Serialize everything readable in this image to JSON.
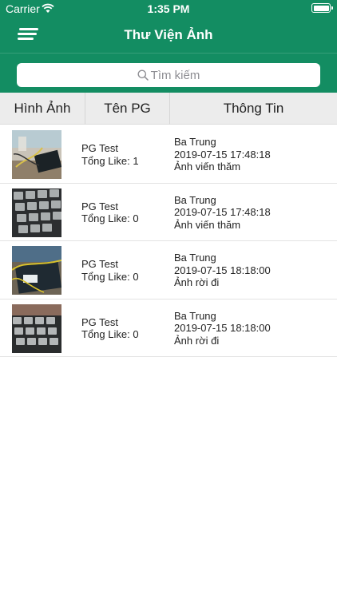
{
  "status_bar": {
    "carrier": "Carrier",
    "time": "1:35 PM"
  },
  "header": {
    "title": "Thư Viện Ảnh",
    "menu_icon": "menu-icon"
  },
  "search": {
    "placeholder": "Tìm kiếm",
    "icon": "search-icon"
  },
  "table": {
    "columns": [
      "Hình Ảnh",
      "Tên PG",
      "Thông Tin"
    ],
    "rows": [
      {
        "name": "PG Test",
        "likes": "Tổng Like: 1",
        "person": "Ba Trung",
        "datetime": "2019-07-15 17:48:18",
        "note": "Ảnh viến thăm",
        "thumb": "desk-cables-photo"
      },
      {
        "name": "PG Test",
        "likes": "Tổng Like: 0",
        "person": "Ba Trung",
        "datetime": "2019-07-15 17:48:18",
        "note": "Ảnh viến thăm",
        "thumb": "keyboard-photo"
      },
      {
        "name": "PG Test",
        "likes": "Tổng Like: 0",
        "person": "Ba Trung",
        "datetime": "2019-07-15 18:18:00",
        "note": "Ảnh rời đi",
        "thumb": "laptop-cable-photo"
      },
      {
        "name": "PG Test",
        "likes": "Tổng Like: 0",
        "person": "Ba Trung",
        "datetime": "2019-07-15 18:18:00",
        "note": "Ảnh rời đi",
        "thumb": "keyboard-photo"
      }
    ]
  },
  "colors": {
    "header_green": "#138d62",
    "table_header_bg": "#ececec"
  }
}
